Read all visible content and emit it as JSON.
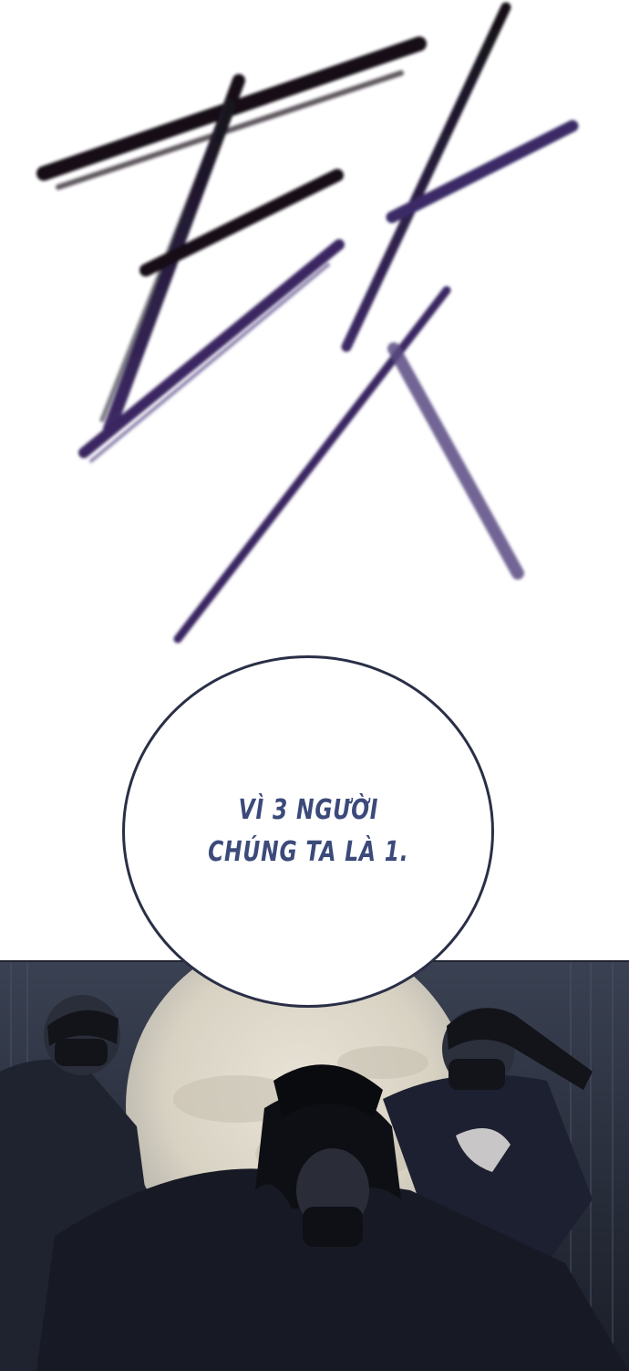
{
  "speech_bubble": {
    "line1": "VÌ 3 NGƯỜI",
    "line2": "CHÚNG TA LÀ 1."
  },
  "sound_effect": {
    "text": "ЕК",
    "colors": {
      "dark": "#15121a",
      "purple": "#3d2a66"
    }
  },
  "scene": {
    "bubble_text_color": "#3b4a7a",
    "bubble_border_color": "#2a2f47",
    "moon_color": "#ddd8cb",
    "sky_color": "#3a4152"
  }
}
